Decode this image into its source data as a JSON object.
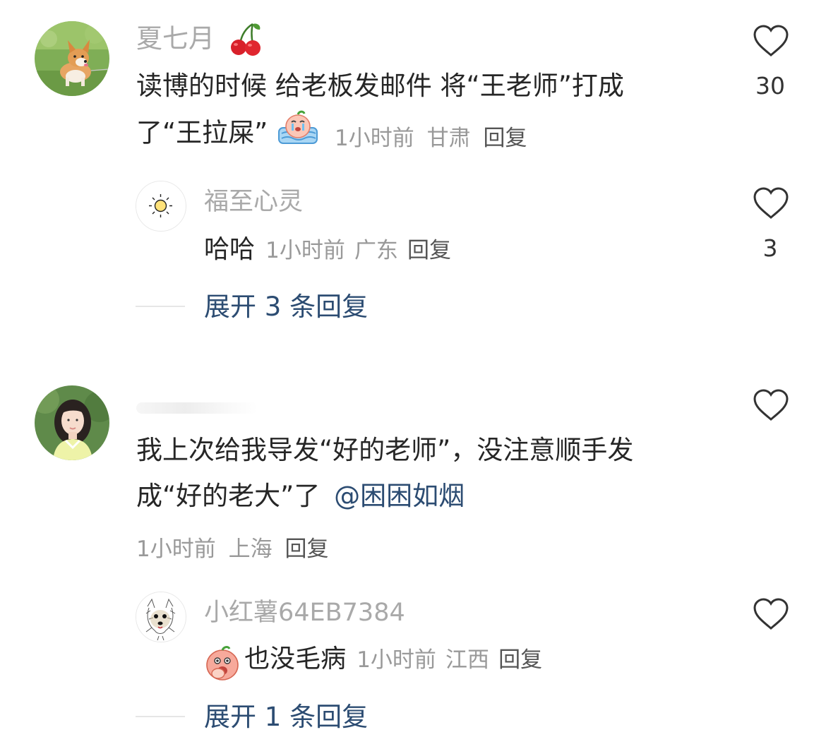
{
  "comments": [
    {
      "username": "夏七月",
      "username_emoji": "cherry-icon",
      "text_line1": "读博的时候 给老板发邮件 将“王老师”打成",
      "text_line2": "了“王拉屎”",
      "inline_emoji": "crying-emoji",
      "time": "1小时前",
      "location": "甘肃",
      "reply_label": "回复",
      "likes": "30",
      "replies": [
        {
          "username": "福至心灵",
          "text": "哈哈",
          "time": "1小时前",
          "location": "广东",
          "reply_label": "回复",
          "likes": "3"
        }
      ],
      "expand_label": "展开 3 条回复"
    },
    {
      "username": "",
      "text_line1": "我上次给我导发“好的老师”，没注意顺手发",
      "text_line2": "成“好的老大”了",
      "mention": "@困困如烟",
      "time": "1小时前",
      "location": "上海",
      "reply_label": "回复",
      "likes": "",
      "replies": [
        {
          "username": "小红薯64EB7384",
          "leading_emoji": "hand-over-mouth-emoji",
          "text": "也没毛病",
          "time": "1小时前",
          "location": "江西",
          "reply_label": "回复",
          "likes": ""
        }
      ],
      "expand_label": "展开 1 条回复"
    }
  ],
  "colors": {
    "username": "#a9a9a9",
    "content": "#262626",
    "meta": "#999999",
    "link": "#2c4c72",
    "divider": "#e6e6e6"
  }
}
